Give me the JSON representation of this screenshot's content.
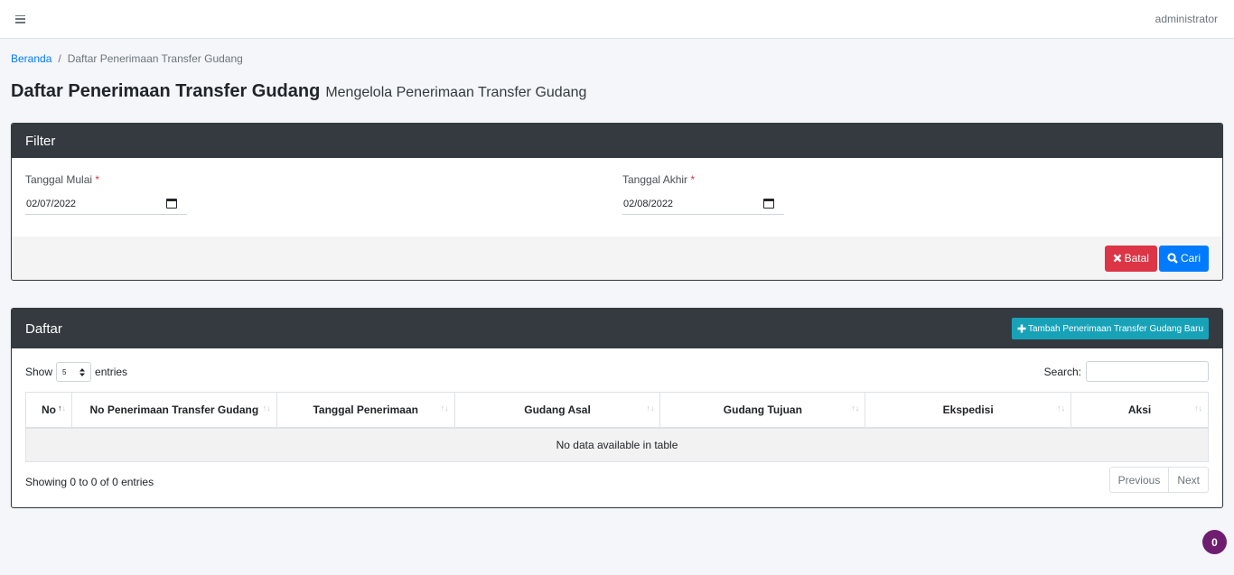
{
  "topbar": {
    "user": "administrator"
  },
  "breadcrumb": {
    "home": "Beranda",
    "separator": "/",
    "current": "Daftar Penerimaan Transfer Gudang"
  },
  "page": {
    "title": "Daftar Penerimaan Transfer Gudang",
    "subtitle": "Mengelola Penerimaan Transfer Gudang"
  },
  "filter": {
    "title": "Filter",
    "start_label": "Tanggal Mulai",
    "start_value": "02/07/2022",
    "end_label": "Tanggal Akhir",
    "end_value": "02/08/2022",
    "required_mark": "*",
    "cancel_label": "Batal",
    "search_label": "Cari"
  },
  "list": {
    "title": "Daftar",
    "add_label": "Tambah Penerimaan Transfer Gudang Baru",
    "show_label": "Show",
    "page_size": "5",
    "entries_label": "entries",
    "search_label": "Search:",
    "columns": [
      "No",
      "No Penerimaan Transfer Gudang",
      "Tanggal Penerimaan",
      "Gudang Asal",
      "Gudang Tujuan",
      "Ekspedisi",
      "Aksi"
    ],
    "empty_text": "No data available in table",
    "info": "Showing 0 to 0 of 0 entries",
    "prev_label": "Previous",
    "next_label": "Next"
  },
  "badge": {
    "count": "0"
  },
  "colors": {
    "header": "#343a40",
    "danger": "#dc3545",
    "primary": "#007bff",
    "info": "#17a2b8",
    "badge": "#6f1e6f"
  }
}
